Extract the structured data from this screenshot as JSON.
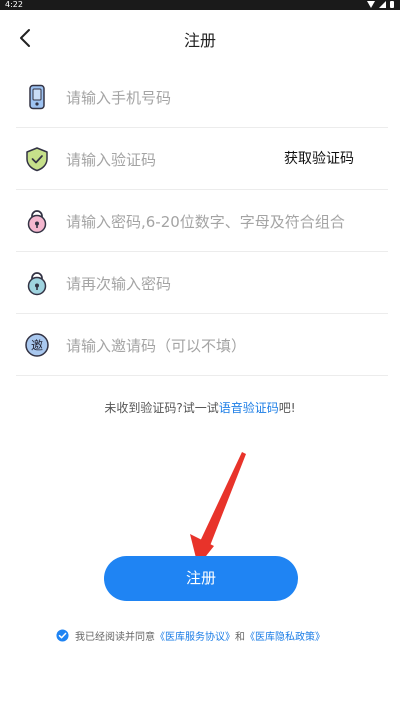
{
  "status_bar": {
    "time": "4:22"
  },
  "header": {
    "title": "注册"
  },
  "form": {
    "phone_placeholder": "请输入手机号码",
    "code_placeholder": "请输入验证码",
    "get_code_label": "获取验证码",
    "password_placeholder": "请输入密码,6-20位数字、字母及符合组合",
    "confirm_placeholder": "请再次输入密码",
    "invite_placeholder": "请输入邀请码（可以不填）"
  },
  "hint": {
    "prefix": "未收到验证码?试一试",
    "link": "语音验证码",
    "suffix": "吧!"
  },
  "submit_label": "注册",
  "agreement": {
    "checked": true,
    "prefix": "我已经阅读并同意",
    "service_link": "《医库服务协议》",
    "and": "和",
    "privacy_link": "《医库隐私政策》"
  },
  "colors": {
    "accent": "#1f84f3",
    "link": "#1b7de6",
    "arrow": "#e8332a"
  },
  "icons": [
    "phone-icon",
    "shield-check-icon",
    "lock-icon",
    "lock-icon",
    "invite-icon",
    "checkbox-icon",
    "back-arrow-icon"
  ]
}
